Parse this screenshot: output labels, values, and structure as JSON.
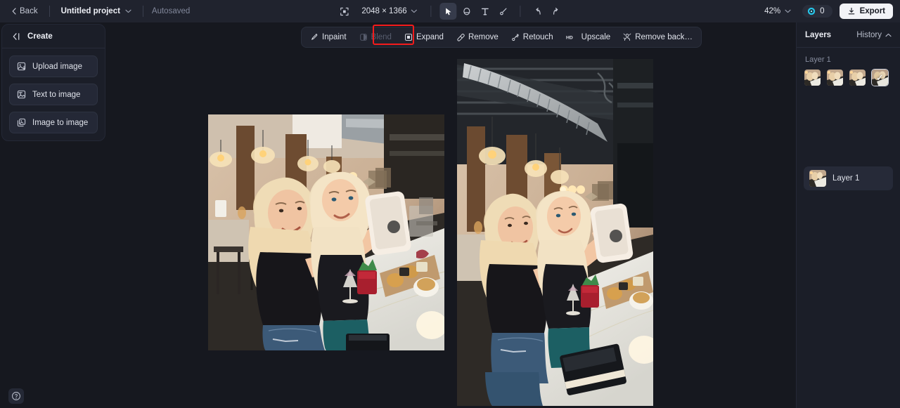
{
  "topbar": {
    "back_label": "Back",
    "project_name": "Untitled project",
    "autosaved_label": "Autosaved",
    "dimensions": "2048 × 1366",
    "zoom_level": "42%",
    "credits_count": "0",
    "export_label": "Export",
    "tools": [
      {
        "name": "crop-tool",
        "label": "Crop"
      },
      {
        "name": "select-tool",
        "label": "Select"
      },
      {
        "name": "eraser-tool",
        "label": "Eraser"
      },
      {
        "name": "text-tool",
        "label": "Text"
      },
      {
        "name": "brush-tool",
        "label": "Brush"
      },
      {
        "name": "undo",
        "label": "Undo"
      },
      {
        "name": "redo",
        "label": "Redo"
      }
    ]
  },
  "sidebar": {
    "title": "Create",
    "items": [
      {
        "label": "Upload image",
        "icon": "upload-image-icon"
      },
      {
        "label": "Text to image",
        "icon": "text-to-image-icon"
      },
      {
        "label": "Image to image",
        "icon": "image-to-image-icon"
      }
    ]
  },
  "edit_toolbar": {
    "items": [
      {
        "label": "Inpaint",
        "icon": "inpaint-icon",
        "disabled": false,
        "highlighted": false
      },
      {
        "label": "Blend",
        "icon": "blend-icon",
        "disabled": true,
        "highlighted": false
      },
      {
        "label": "Expand",
        "icon": "expand-icon",
        "disabled": false,
        "highlighted": true
      },
      {
        "label": "Remove",
        "icon": "remove-icon",
        "disabled": false,
        "highlighted": false
      },
      {
        "label": "Retouch",
        "icon": "retouch-icon",
        "disabled": false,
        "highlighted": false
      },
      {
        "label": "Upscale",
        "icon": "upscale-icon",
        "disabled": false,
        "highlighted": false
      },
      {
        "label": "Remove back…",
        "icon": "remove-background-icon",
        "disabled": false,
        "highlighted": false
      }
    ]
  },
  "layers_panel": {
    "title": "Layers",
    "history_label": "History",
    "layer_group_label": "Layer 1",
    "history_thumbs": [
      {
        "selected": false
      },
      {
        "selected": false
      },
      {
        "selected": false
      },
      {
        "selected": true
      }
    ],
    "layers": [
      {
        "label": "Layer 1"
      }
    ]
  },
  "canvas": {
    "images": [
      {
        "name": "original-image",
        "alt": "Two women taking a selfie at a restaurant bar"
      },
      {
        "name": "expanded-image",
        "alt": "Expanded version of the selfie photo showing more ceiling and counter"
      }
    ]
  },
  "help": {
    "label": "Help"
  }
}
